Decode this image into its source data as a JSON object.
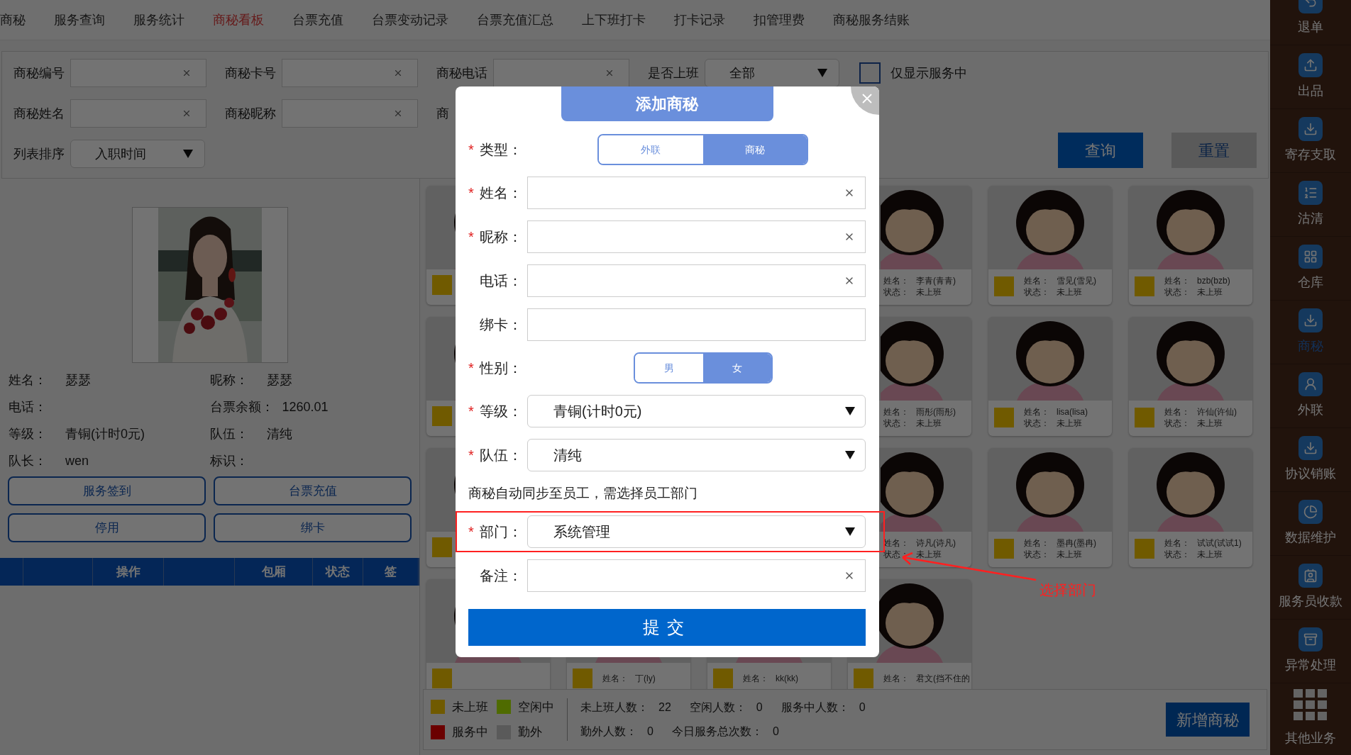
{
  "nav_tabs": [
    {
      "label": "商秘",
      "selected": false
    },
    {
      "label": "服务查询",
      "selected": false
    },
    {
      "label": "服务统计",
      "selected": false
    },
    {
      "label": "商秘看板",
      "selected": true
    },
    {
      "label": "台票充值",
      "selected": false
    },
    {
      "label": "台票变动记录",
      "selected": false
    },
    {
      "label": "台票充值汇总",
      "selected": false
    },
    {
      "label": "上下班打卡",
      "selected": false
    },
    {
      "label": "打卡记录",
      "selected": false
    },
    {
      "label": "扣管理费",
      "selected": false
    },
    {
      "label": "商秘服务结账",
      "selected": false
    }
  ],
  "filters": {
    "rows": [
      [
        {
          "kind": "input",
          "label": "商秘编号"
        },
        {
          "kind": "input",
          "label": "商秘卡号"
        },
        {
          "kind": "input",
          "label": "商秘电话"
        },
        {
          "kind": "select",
          "label": "是否上班",
          "value": "全部"
        },
        {
          "kind": "checkbox",
          "label": "仅显示服务中",
          "checked": false
        }
      ],
      [
        {
          "kind": "input",
          "label": "商秘姓名"
        },
        {
          "kind": "input",
          "label": "商秘昵称"
        },
        {
          "kind": "label",
          "label": "商"
        }
      ],
      [
        {
          "kind": "select",
          "label": "列表排序",
          "value": "入职时间"
        }
      ]
    ],
    "buttons": [
      {
        "label": "查询",
        "kind": "primary"
      },
      {
        "label": "重置",
        "kind": "secondary"
      }
    ]
  },
  "detail": {
    "info": [
      {
        "label": "姓名：",
        "value": "瑟瑟"
      },
      {
        "label": "昵称：",
        "value": "瑟瑟"
      },
      {
        "label": "电话："
      },
      {
        "label": "台票余额：",
        "value": "1260.01"
      },
      {
        "label": "等级：",
        "value": "青铜(计时0元)"
      },
      {
        "label": "队伍：",
        "value": "清纯"
      },
      {
        "label": "队长：",
        "value": "wen"
      },
      {
        "label": "标识："
      }
    ],
    "buttons": [
      "服务签到",
      "台票充值",
      "停用",
      "绑卡"
    ],
    "table_columns": [
      {
        "kind": "blank"
      },
      {
        "kind": "blank"
      },
      {
        "kind": "text",
        "label": "操作"
      },
      {
        "kind": "blank"
      },
      {
        "kind": "text",
        "label": "包厢"
      },
      {
        "kind": "text",
        "label": "状态"
      },
      {
        "kind": "text",
        "label": "签"
      }
    ]
  },
  "cards": [
    {
      "color": "#705a00"
    },
    {
      "name_label": "姓名：",
      "name": "李青(青青)",
      "status_label": "状态：",
      "status": "未上班"
    },
    {
      "color": "#705a00",
      "name_label": "姓名：",
      "name": "雪见(雪见)",
      "status_label": "状态：",
      "status": "未上班"
    },
    {
      "color": "#705a00",
      "name_label": "姓名：",
      "name": "bzb(bzb)",
      "status_label": "状态：",
      "status": "未上班"
    },
    {
      "color": "#705a00"
    },
    {
      "name_label": "姓名：",
      "name": "雨彤(雨彤)",
      "status_label": "状态：",
      "status": "未上班"
    },
    {
      "color": "#705a00",
      "name_label": "姓名：",
      "name": "lisa(lisa)",
      "status_label": "状态：",
      "status": "未上班"
    },
    {
      "color": "#705a00",
      "name_label": "姓名：",
      "name": "许仙(许仙)",
      "status_label": "状态：",
      "status": "未上班"
    },
    {
      "color": "#705a00"
    },
    {
      "name_label": "姓名：",
      "name": "诗凡(诗凡)",
      "status_label": "状态：",
      "status": "未上班"
    },
    {
      "color": "#705a00",
      "name_label": "姓名：",
      "name": "墨冉(墨冉)",
      "status_label": "状态：",
      "status": "未上班"
    },
    {
      "color": "#705a00",
      "name_label": "姓名：",
      "name": "试试(试试1)",
      "status_label": "状态：",
      "status": "未上班"
    },
    {
      "color": "#705a00"
    },
    {
      "color": "#705a00",
      "name_label": "姓名：",
      "name": "丁(ly)"
    },
    {
      "color": "#705a00",
      "name_label": "姓名：",
      "name": "kk(kk)"
    },
    {
      "color": "#705a00",
      "name_label": "姓名：",
      "name": "君文(挡不住的"
    }
  ],
  "legend": [
    {
      "label": "未上班",
      "color": "#705a00"
    },
    {
      "label": "空闲中",
      "color": "#4f6b00"
    },
    {
      "label": "服务中",
      "color": "#6b0000"
    },
    {
      "label": "勤外",
      "color": "#5a5a5a"
    }
  ],
  "stats_rows": [
    [
      {
        "label": "未上班人数：",
        "value": "22"
      },
      {
        "label": "空闲人数：",
        "value": "0"
      },
      {
        "label": "服务中人数：",
        "value": "0"
      }
    ],
    [
      {
        "label": "勤外人数：",
        "value": "0"
      },
      {
        "label": "今日服务总次数：",
        "value": "0"
      }
    ]
  ],
  "add_button": "新增商秘",
  "sidebar": [
    {
      "label": "退单",
      "selected": false
    },
    {
      "label": "出品",
      "selected": false
    },
    {
      "label": "寄存支取",
      "selected": false
    },
    {
      "label": "沽清",
      "selected": false
    },
    {
      "label": "仓库",
      "selected": false
    },
    {
      "label": "商秘",
      "selected": true
    },
    {
      "label": "外联",
      "selected": false
    },
    {
      "label": "协议销账",
      "selected": false
    },
    {
      "label": "数据维护",
      "selected": false
    },
    {
      "label": "服务员收款",
      "selected": false
    },
    {
      "label": "异常处理",
      "selected": false
    }
  ],
  "sidebar_more": "其他业务",
  "modal": {
    "title": "添加商秘",
    "fields": [
      {
        "kind": "toggle",
        "label": "类型：",
        "required_mark": "*",
        "options": [
          {
            "label": "外联",
            "selected": false
          },
          {
            "label": "商秘",
            "selected": true
          }
        ]
      },
      {
        "kind": "input",
        "label": "姓名：",
        "required_mark": "*",
        "clearable": true
      },
      {
        "kind": "input",
        "label": "昵称：",
        "required_mark": "*",
        "clearable": true
      },
      {
        "kind": "input",
        "label": "电话：",
        "clearable": true
      },
      {
        "kind": "input",
        "label": "绑卡：",
        "clearable": false
      },
      {
        "kind": "toggle",
        "label": "性别：",
        "required_mark": "*",
        "options": [
          {
            "label": "男",
            "selected": false
          },
          {
            "label": "女",
            "selected": true
          }
        ]
      },
      {
        "kind": "select",
        "label": "等级：",
        "required_mark": "*",
        "value": "青铜(计时0元)"
      },
      {
        "kind": "select",
        "label": "队伍：",
        "required_mark": "*",
        "value": "清纯"
      },
      {
        "kind": "note",
        "text": "商秘自动同步至员工，需选择员工部门"
      },
      {
        "kind": "select",
        "label": "部门：",
        "required_mark": "*",
        "value": "系统管理",
        "highlighted": true
      },
      {
        "kind": "input",
        "label": "备注：",
        "clearable": true
      }
    ],
    "submit": "提交"
  },
  "annotation": {
    "text": "选择部门"
  }
}
